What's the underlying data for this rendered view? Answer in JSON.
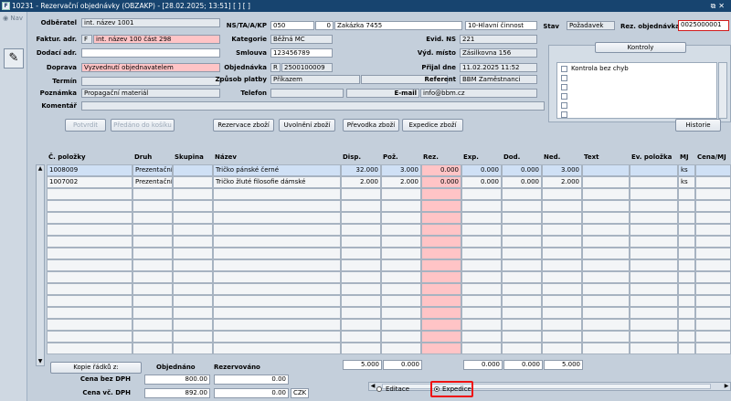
{
  "title": "10231 - Rezervační objednávky (OBZAKP) - [28.02.2025; 13:51]  [  ]  [  ]",
  "sidebar": {
    "nav": "Nav"
  },
  "header": {
    "odberatel": {
      "label": "Odběratel",
      "value": "int. název 1001"
    },
    "faktur": {
      "label": "Faktur. adr.",
      "code": "F",
      "value": "int. název 100 část 298"
    },
    "dodaci": {
      "label": "Dodací adr.",
      "value": ""
    },
    "doprava": {
      "label": "Doprava",
      "value": "Vyzvednutí objednavatelem"
    },
    "termin": {
      "label": "Termín",
      "value": ""
    },
    "poznamka": {
      "label": "Poznámka",
      "value": "Propagační materiál"
    },
    "komentar": {
      "label": "Komentář",
      "value": ""
    },
    "ns": {
      "label": "NS/TA/A/KP",
      "v1": "050",
      "v2": "0",
      "v3": "Zakázka 7455",
      "v4": "10-Hlavní činnost"
    },
    "kategorie": {
      "label": "Kategorie",
      "value": "Běžná MC"
    },
    "smlouva": {
      "label": "Smlouva",
      "value": "123456789"
    },
    "objednavka": {
      "label": "Objednávka",
      "code": "R",
      "value": "2500100009"
    },
    "zpusob": {
      "label": "Způsob platby",
      "value": "Příkazem"
    },
    "telefon": {
      "label": "Telefon",
      "value": ""
    },
    "evid": {
      "label": "Evid. NS",
      "value": "221"
    },
    "vyd": {
      "label": "Výd. místo",
      "value": "Zásilkovna 156"
    },
    "prijal": {
      "label": "Přijal dne",
      "value": "11.02.2025 11:52"
    },
    "referent": {
      "label": "Referent",
      "value": "BBM Zaměstnanci"
    },
    "email": {
      "label": "E-mail",
      "value": "info@bbm.cz"
    },
    "stav": {
      "label": "Stav",
      "value": "Požadavek"
    },
    "rez": {
      "label": "Rez. objednávka",
      "value": "0025000001"
    }
  },
  "kontroly": {
    "button": "Kontroly",
    "items": [
      "Kontrola bez chyb",
      "",
      "",
      "",
      "",
      ""
    ]
  },
  "toolbar": {
    "potvrdit": "Potvrdit",
    "predano": "Předáno do košíku",
    "rezervace": "Rezervace zboží",
    "uvolneni": "Uvolnění zboží",
    "prevodka": "Převodka zboží",
    "expedice": "Expedice zboží",
    "historie": "Historie"
  },
  "table": {
    "columns": [
      "Č. položky",
      "Druh",
      "Skupina",
      "Název",
      "Disp.",
      "Pož.",
      "Rez.",
      "Exp.",
      "Dod.",
      "Ned.",
      "Text",
      "Ev. položka",
      "MJ",
      "Cena/MJ"
    ],
    "rows": [
      [
        "1008009",
        "Prezentační",
        "",
        "Tričko pánské černé",
        "32.000",
        "3.000",
        "0.000",
        "0.000",
        "0.000",
        "3.000",
        "",
        "",
        "ks",
        ""
      ],
      [
        "1007002",
        "Prezentační",
        "",
        "Tričko žluté filosofie dámské",
        "2.000",
        "2.000",
        "0.000",
        "0.000",
        "0.000",
        "2.000",
        "",
        "",
        "ks",
        ""
      ]
    ],
    "totals": [
      "5.000",
      "0.000",
      "0.000",
      "0.000",
      "5.000"
    ]
  },
  "footer": {
    "kopie": "Kopie řádků z:",
    "objednano_hdr": "Objednáno",
    "rezervovano_hdr": "Rezervováno",
    "cena_bez": {
      "label": "Cena bez DPH",
      "objednano": "800.00",
      "rezervovano": "0.00"
    },
    "cena_vc": {
      "label": "Cena vč. DPH",
      "objednano": "892.00",
      "rezervovano": "0.00",
      "mena": "CZK"
    },
    "radio_editace": "Editace",
    "radio_expedice": "Expedice"
  }
}
